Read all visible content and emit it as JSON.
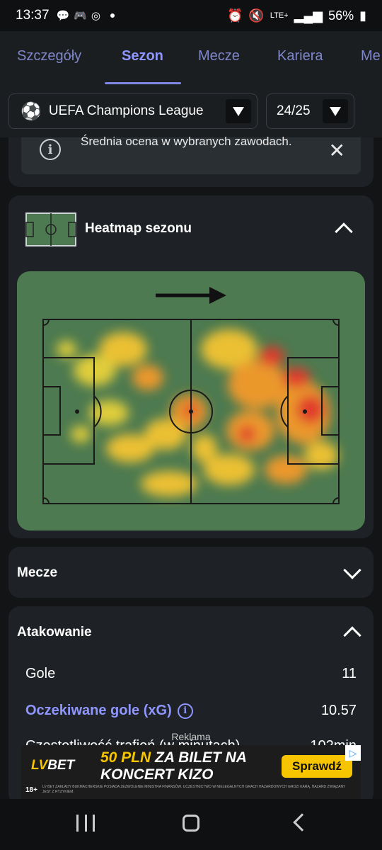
{
  "status": {
    "time": "13:37",
    "battery": "56%",
    "network": "LTE+"
  },
  "tabs": [
    {
      "label": "Szczegóły"
    },
    {
      "label": "Sezon"
    },
    {
      "label": "Mecze"
    },
    {
      "label": "Kariera"
    },
    {
      "label": "Me"
    }
  ],
  "filters": {
    "competition": "UEFA Champions League",
    "season": "24/25"
  },
  "info": {
    "text": "Średnia ocena w wybranych zawodach."
  },
  "heatmap": {
    "title": "Heatmap sezonu"
  },
  "sections": {
    "matches": "Mecze",
    "attacking": "Atakowanie"
  },
  "stats": [
    {
      "label": "Gole",
      "value": "11"
    },
    {
      "label": "Oczekiwane gole (xG)",
      "value": "10.57"
    },
    {
      "label": "Częstotliwość trafień (w minutach)",
      "value": "102min"
    }
  ],
  "ad": {
    "label": "Reklama",
    "brand_lv": "LV",
    "brand_bet": "BET",
    "headline_1": "50 PLN",
    "headline_2": " ZA BILET NA",
    "headline_3": "KONCERT KIZO",
    "cta": "Sprawdź",
    "age": "18+",
    "disclaimer": "LV BET ZAKŁADY BUKMACHERSKIE POSIADA ZEZWOLENIE MINISTRA FINANSÓW. UCZESTNICTWO W NIELEGALNYCH GRACH HAZARDOWYCH GROZI KARĄ. HAZARD ZWIĄZANY JEST Z RYZYKIEM."
  },
  "colors": {
    "accent": "#8f96ff",
    "pitch": "#4d7a50",
    "card": "#1e2226",
    "ad_yellow": "#f6c500"
  }
}
